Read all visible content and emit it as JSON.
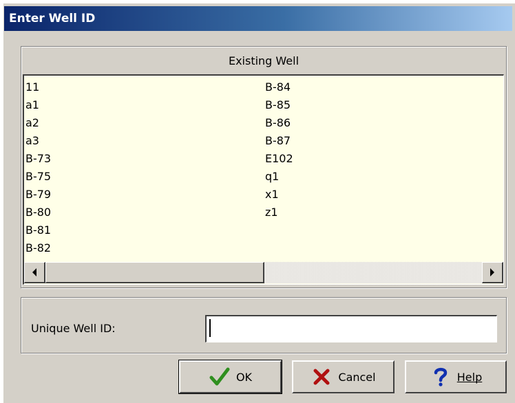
{
  "window": {
    "title": "Enter Well ID"
  },
  "existing_wells": {
    "header": "Existing Well",
    "column1": [
      "11",
      "a1",
      "a2",
      "a3",
      "B-73",
      "B-75",
      "B-79",
      "B-80",
      "B-81",
      "B-82"
    ],
    "column2": [
      "B-84",
      "B-85",
      "B-86",
      "B-87",
      "E102",
      "q1",
      "x1",
      "z1"
    ]
  },
  "well_id": {
    "label": "Unique Well ID:",
    "value": ""
  },
  "buttons": {
    "ok": "OK",
    "cancel": "Cancel",
    "help": "Help"
  },
  "icons": {
    "ok": "checkmark-icon",
    "cancel": "x-icon",
    "help": "question-mark-icon"
  },
  "colors": {
    "title_start": "#0a246a",
    "title_end": "#a6caf0",
    "list_bg": "#ffffe8",
    "ok_green": "#2f8f1f",
    "cancel_red": "#b01010",
    "help_blue": "#1030b0"
  }
}
